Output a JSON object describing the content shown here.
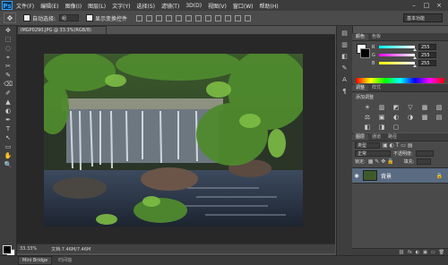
{
  "app": {
    "logo": "Ps"
  },
  "menu": [
    "文件(F)",
    "编辑(E)",
    "图像(I)",
    "图层(L)",
    "文字(Y)",
    "选择(S)",
    "滤镜(T)",
    "3D(D)",
    "视图(V)",
    "窗口(W)",
    "帮助(H)"
  ],
  "window_controls": {
    "minimize": "–",
    "maximize": "□",
    "close": "×"
  },
  "options": {
    "auto_select_label": "自动选择:",
    "auto_select_value": "组",
    "show_transform_label": "显示变换控件",
    "workspace": "基本功能"
  },
  "document": {
    "tab_title": "IMGP0290.JPG @ 33.3%(RGB/8)",
    "zoom": "33.33%",
    "doc_size": "文档:7.46M/7.46M"
  },
  "bottom_tabs": {
    "mini_bridge": "Mini Bridge",
    "timeline": "时间轴"
  },
  "color_panel": {
    "tabs": [
      "颜色",
      "色板"
    ],
    "channels": [
      {
        "label": "R",
        "value": "255",
        "color": "#ff6a6a"
      },
      {
        "label": "G",
        "value": "255",
        "color": "#6aff6a"
      },
      {
        "label": "B",
        "value": "255",
        "color": "#6a9aff"
      }
    ]
  },
  "adjustments_panel": {
    "tabs": [
      "调整",
      "样式"
    ],
    "title": "添加调整",
    "icons": [
      "☀",
      "▥",
      "◩",
      "▽",
      "▦",
      "▧",
      "⚖",
      "▣",
      "◐",
      "◑",
      "▩",
      "▤",
      "◧",
      "◨",
      "▢"
    ]
  },
  "layers_panel": {
    "tabs": [
      "图层",
      "通道",
      "路径"
    ],
    "kind_label": "类型",
    "blend_mode": "正常",
    "opacity_label": "不透明度:",
    "lock_label": "锁定:",
    "fill_label": "填充:",
    "layers": [
      {
        "name": "背景",
        "visible": true,
        "locked": true
      }
    ],
    "footer_icons": [
      "⛓",
      "fx",
      "◐",
      "▣",
      "▭",
      "🗑"
    ]
  },
  "tools": [
    "✥",
    "⬚",
    "◌",
    "⌖",
    "✂",
    "✎",
    "⌫",
    "✐",
    "▲",
    "◐",
    "✒",
    "T",
    "↖",
    "▭",
    "✋",
    "🔍"
  ],
  "panel_strip_icons": [
    "▤",
    "▥",
    "◧",
    "✎",
    "A",
    "¶"
  ]
}
